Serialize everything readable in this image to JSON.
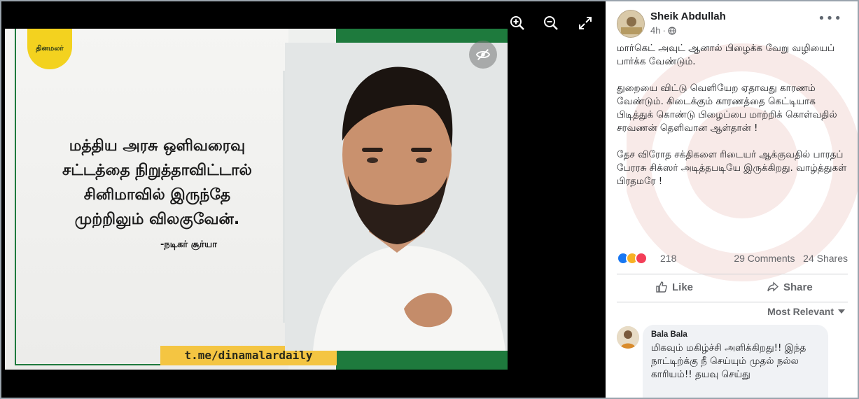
{
  "viewer": {
    "tools": [
      {
        "name": "zoom-in-icon"
      },
      {
        "name": "zoom-out-icon"
      },
      {
        "name": "fullscreen-icon"
      }
    ],
    "image": {
      "logo_text": "தினமலர்",
      "quote_lines": [
        "மத்திய அரசு ஒளிவரைவு",
        "சட்டத்தை நிறுத்தாவிட்டால்",
        "சினிமாவில் இருந்தே",
        "முற்றிலும் விலகுவேன்."
      ],
      "attribution": "-நடிகர் சூர்யா",
      "telegram_link": "t.me/dinamalardaily",
      "accent_green": "#1e7a3d",
      "accent_yellow": "#f4c542"
    }
  },
  "post": {
    "author": "Sheik Abdullah",
    "time": "4h",
    "privacy_icon": "globe-icon",
    "paragraphs": [
      "மார்கெட் அவுட் ஆனால் பிழைக்க வேறு வழியைப் பார்க்க வேண்டும்.",
      "துறையை விட்டு வெளியேற ஏதாவது காரணம் வேண்டும். கிடைக்கும் காரணத்தை கெட்டியாக பிடித்துக் கொண்டு பிழைப்பை மாற்றிக் கொள்வதில் சரவணன் தெளிவான ஆள்தான் !",
      "தேச விரோத சக்திகளை ரிடையர் ஆக்குவதில் பாரதப் பேரரசு சிக்ஸர் அடித்தபடியே இருக்கிறது. வாழ்த்துகள் பிரதமரே !"
    ],
    "reactions": {
      "icons": [
        "like-icon",
        "haha-icon",
        "love-icon"
      ],
      "count": "218",
      "comments": "29 Comments",
      "shares": "24 Shares"
    },
    "actions": {
      "like": "Like",
      "share": "Share"
    },
    "sort_label": "Most Relevant",
    "comments": [
      {
        "name": "Bala Bala",
        "text": "மிகவும் மகிழ்ச்சி அளிக்கிறது!! இந்த நாட்டிற்க்கு நீ செய்யும் முதல் நல்ல காரியம்!! தயவு செய்து"
      }
    ]
  }
}
